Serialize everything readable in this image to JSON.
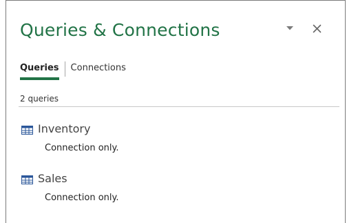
{
  "pane": {
    "title": "Queries & Connections",
    "options_icon": "chevron-down-icon",
    "close_icon": "close-icon"
  },
  "tabs": [
    {
      "label": "Queries",
      "active": true
    },
    {
      "label": "Connections",
      "active": false
    }
  ],
  "query_count_label": "2 queries",
  "queries": [
    {
      "name": "Inventory",
      "status": "Connection only.",
      "icon": "table-icon"
    },
    {
      "name": "Sales",
      "status": "Connection only.",
      "icon": "table-icon"
    }
  ],
  "colors": {
    "accent": "#217346",
    "border": "#7a7a7a",
    "icon_blue": "#2b579a"
  }
}
